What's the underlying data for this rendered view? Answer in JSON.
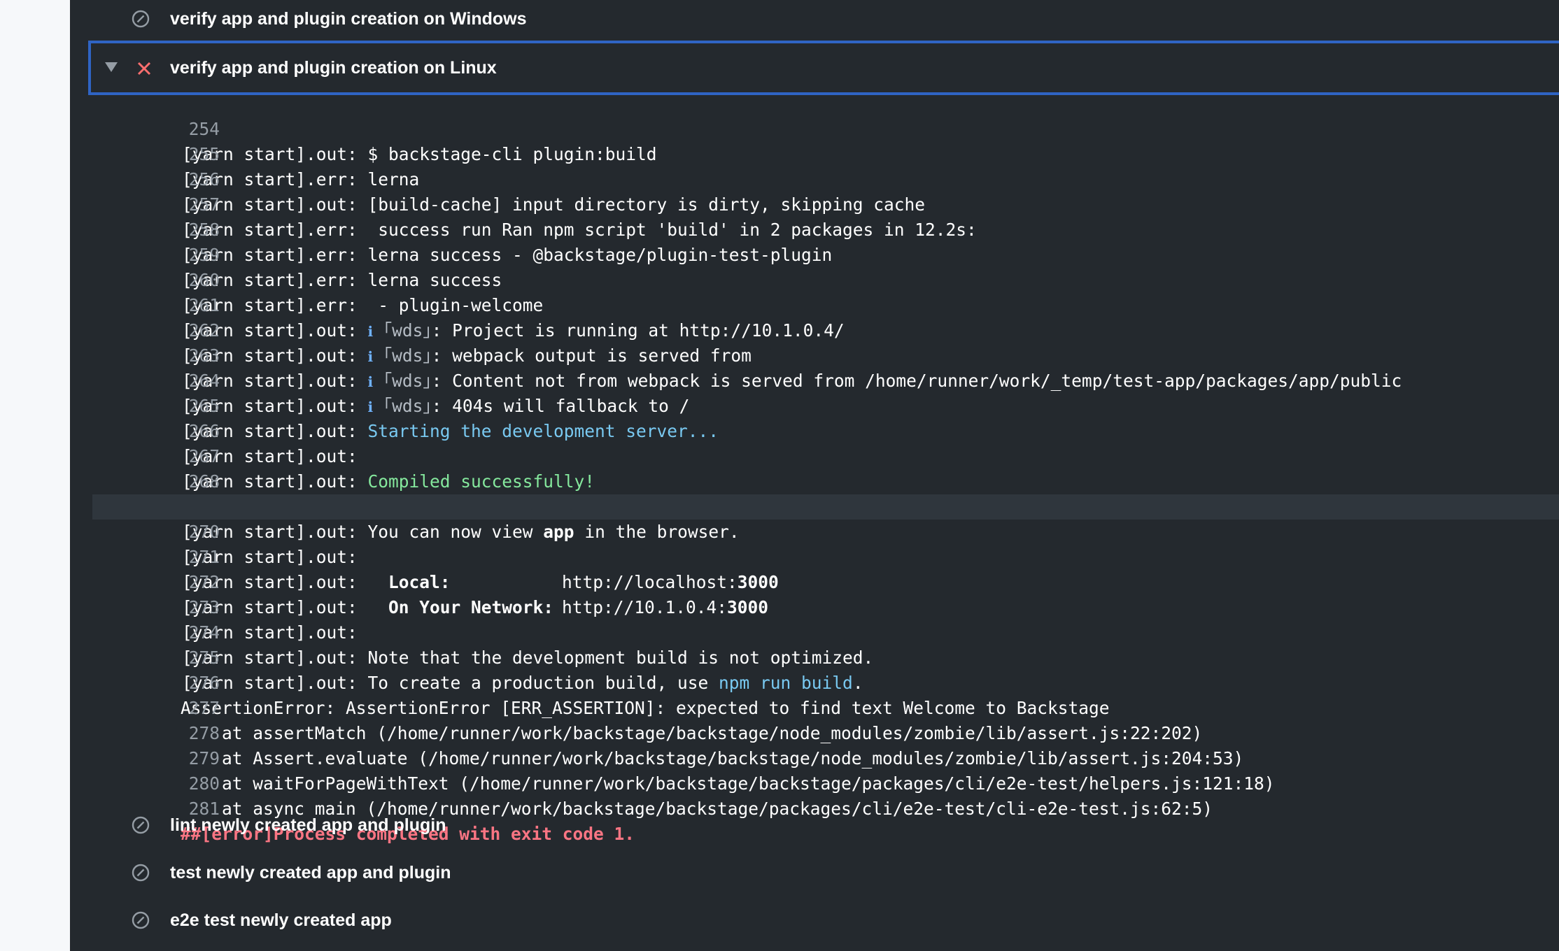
{
  "steps": {
    "windows": "verify app and plugin creation on Windows",
    "linux": "verify app and plugin creation on Linux",
    "lint": "lint newly created app and plugin",
    "test": "test newly created app and plugin",
    "e2e": "e2e test newly created app"
  },
  "icons": {
    "skipped": "skipped-circle-slash-icon",
    "failed": "x-icon",
    "expand": "caret-down-icon"
  },
  "colors": {
    "background": "#24292e",
    "selection_border": "#2f64c4",
    "failed_icon": "#f96e6e",
    "error_text": "#f97583",
    "success_text": "#85e89d",
    "link_text": "#79c9f1"
  },
  "log": {
    "prefix_out": "[yarn start].out:",
    "prefix_err": "[yarn start].err:",
    "wds_icon": "ℹ",
    "wds_tag": "｢wds｣",
    "lines": [
      {
        "n": "254",
        "a": "[yarn start].out: $ backstage-cli plugin:build"
      },
      {
        "n": "255",
        "a": "[yarn start].err: lerna"
      },
      {
        "n": "256",
        "a": "[yarn start].out: [build-cache] input directory is dirty, skipping cache"
      },
      {
        "n": "257",
        "a": "[yarn start].err:  success run Ran npm script 'build' in 2 packages in 12.2s:"
      },
      {
        "n": "258",
        "a": "[yarn start].err: lerna success - @backstage/plugin-test-plugin"
      },
      {
        "n": "259",
        "a": "[yarn start].err: lerna success"
      },
      {
        "n": "260",
        "a": "[yarn start].err:  - plugin-welcome"
      },
      {
        "n": "261",
        "b": ": Project is running at http://10.1.0.4/"
      },
      {
        "n": "262",
        "b": ": webpack output is served from"
      },
      {
        "n": "263",
        "b": ": Content not from webpack is served from /home/runner/work/_temp/test-app/packages/app/public"
      },
      {
        "n": "264",
        "b": ": 404s will fallback to /"
      },
      {
        "n": "265",
        "c": "Starting the development server..."
      },
      {
        "n": "266"
      },
      {
        "n": "267",
        "c": "Compiled successfully!"
      },
      {
        "n": "268"
      },
      {
        "n": "269",
        "c1": "You can now view ",
        "c2": "app",
        "c3": " in the browser."
      },
      {
        "n": "270"
      },
      {
        "n": "271",
        "k": "Local:",
        "u1": "http://localhost:",
        "u2": "3000"
      },
      {
        "n": "272",
        "k": "On Your Network:",
        "u1": "http://10.1.0.4:",
        "u2": "3000"
      },
      {
        "n": "273"
      },
      {
        "n": "274",
        "c": "Note that the development build is not optimized."
      },
      {
        "n": "275",
        "c1": "To create a production build, use ",
        "c2": "npm run build",
        "c3": "."
      },
      {
        "n": "276",
        "a": "AssertionError: AssertionError [ERR_ASSERTION]: expected to find text Welcome to Backstage"
      },
      {
        "n": "277",
        "a": "    at assertMatch (/home/runner/work/backstage/backstage/node_modules/zombie/lib/assert.js:22:202)"
      },
      {
        "n": "278",
        "a": "    at Assert.evaluate (/home/runner/work/backstage/backstage/node_modules/zombie/lib/assert.js:204:53)"
      },
      {
        "n": "279",
        "a": "    at waitForPageWithText (/home/runner/work/backstage/backstage/packages/cli/e2e-test/helpers.js:121:18)"
      },
      {
        "n": "280",
        "a": "    at async main (/home/runner/work/backstage/backstage/packages/cli/e2e-test/cli-e2e-test.js:62:5)"
      },
      {
        "n": "281",
        "a": "##[error]Process completed with exit code 1."
      }
    ]
  }
}
